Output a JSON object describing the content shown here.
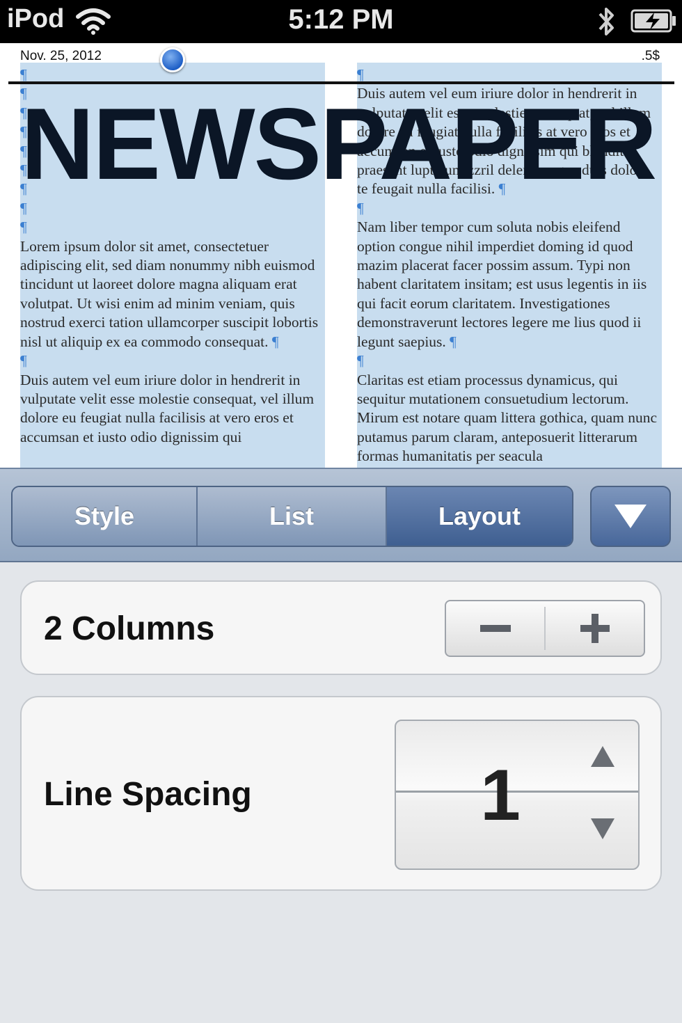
{
  "status_bar": {
    "carrier": "iPod",
    "time": "5:12 PM"
  },
  "document": {
    "date": "Nov. 25, 2012",
    "page_marker": ".5$",
    "headline": "NEWSPAPER",
    "pilcrow": "¶",
    "left_column": {
      "paragraph_1": "Lorem ipsum dolor sit amet, consectetuer adipiscing elit, sed diam nonummy nibh euismod tincidunt ut laoreet dolore magna aliquam erat volutpat. Ut wisi enim ad minim veniam, quis nostrud exerci tation ullamcorper suscipit lobortis nisl ut aliquip ex ea commodo consequat.",
      "paragraph_2": "Duis autem vel eum iriure dolor in hendrerit in vulputate velit esse molestie consequat, vel illum dolore eu feugiat nulla facilisis at vero eros et accumsan et iusto odio dignissim qui"
    },
    "right_column": {
      "paragraph_1": "Duis autem vel eum iriure dolor in hendrerit in vulputate velit esse molestie consequat, vel illum dolore eu feugiat nulla facilisis at vero eros et accumsan et iusto odio dignissim qui blandit praesent luptatum zzril delenit augue duis dolore te feugait nulla facilisi.",
      "paragraph_2": "Nam liber tempor cum soluta nobis eleifend option congue nihil imperdiet doming id quod mazim placerat facer possim assum. Typi non habent claritatem insitam; est usus legentis in iis qui facit eorum claritatem. Investigationes demonstraverunt lectores legere me lius quod ii legunt saepius.",
      "paragraph_3": "Claritas est etiam processus dynamicus, qui sequitur mutationem consuetudium lectorum. Mirum est notare quam littera gothica, quam nunc putamus parum claram, anteposuerit litterarum formas humanitatis per seacula"
    }
  },
  "toolbar": {
    "tabs": [
      {
        "label": "Style",
        "selected": false
      },
      {
        "label": "List",
        "selected": false
      },
      {
        "label": "Layout",
        "selected": true
      }
    ],
    "dropdown_icon": "triangle-down-icon"
  },
  "layout_panel": {
    "columns_label": "2 Columns",
    "minus_icon": "minus-icon",
    "plus_icon": "plus-icon",
    "line_spacing_label": "Line Spacing",
    "line_spacing_value": "1"
  },
  "colors": {
    "selection": "#c8ddef",
    "pilcrow": "#3b7fd1",
    "toolbar_selected": "#3f5f91"
  }
}
